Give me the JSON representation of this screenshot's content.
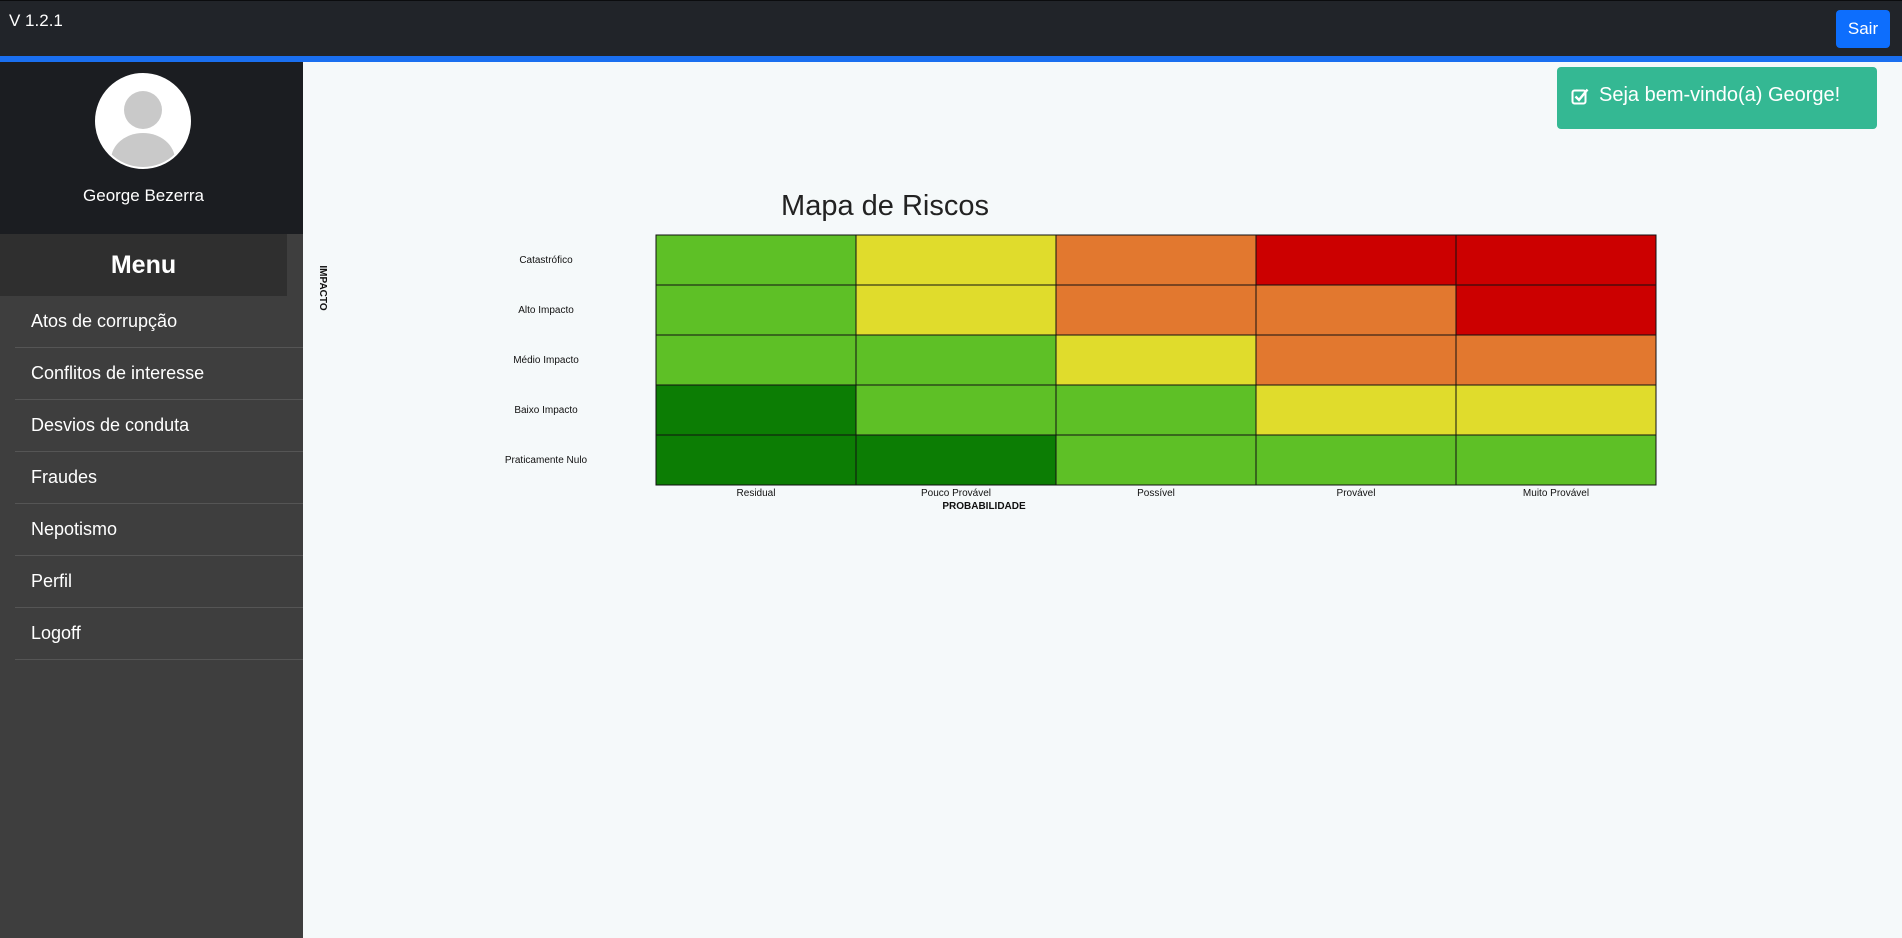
{
  "app": {
    "version": "V 1.2.1",
    "exit_label": "Sair"
  },
  "sidebar": {
    "user_name": "George Bezerra",
    "menu_title": "Menu",
    "items": [
      {
        "label": "Atos de corrupção"
      },
      {
        "label": "Conflitos de interesse"
      },
      {
        "label": "Desvios de conduta"
      },
      {
        "label": "Fraudes"
      },
      {
        "label": "Nepotismo"
      },
      {
        "label": "Perfil"
      },
      {
        "label": "Logoff"
      }
    ]
  },
  "toast": {
    "message": "Seja bem-vindo(a) George!",
    "icon": "check-square-icon"
  },
  "colors": {
    "topbar": "#212429",
    "accent": "#1a6ff0",
    "toast": "#34b893",
    "dark_green": "#0c7d04",
    "green": "#5ec026",
    "yellow": "#e0dc2c",
    "orange": "#e2782f",
    "red": "#cc0000"
  },
  "chart_data": {
    "type": "heatmap",
    "title": "Mapa de Riscos",
    "xlabel": "PROBABILIDADE",
    "ylabel": "IMPACTO",
    "x": [
      "Residual",
      "Pouco Provável",
      "Possível",
      "Provável",
      "Muito Provável"
    ],
    "y": [
      "Catastrófico",
      "Alto Impacto",
      "Médio Impacto",
      "Baixo Impacto",
      "Praticamente Nulo"
    ],
    "cells": [
      [
        "green",
        "yellow",
        "orange",
        "red",
        "red"
      ],
      [
        "green",
        "yellow",
        "orange",
        "orange",
        "red"
      ],
      [
        "green",
        "green",
        "yellow",
        "orange",
        "orange"
      ],
      [
        "dark_green",
        "green",
        "green",
        "yellow",
        "yellow"
      ],
      [
        "dark_green",
        "dark_green",
        "green",
        "green",
        "green"
      ]
    ]
  }
}
